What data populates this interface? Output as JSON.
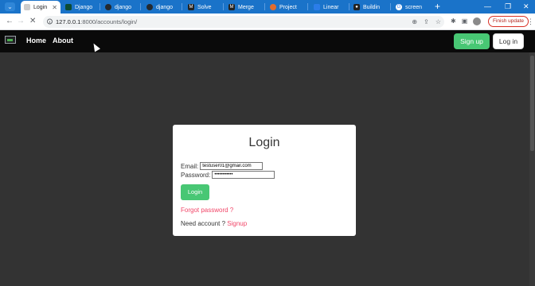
{
  "browser": {
    "active_tab": {
      "title": "Login"
    },
    "tabs": [
      {
        "title": "Django",
        "icon": "django-icon",
        "color": "#0c4b33"
      },
      {
        "title": "django",
        "icon": "github-icon",
        "color": "#24292f"
      },
      {
        "title": "django",
        "icon": "github-icon",
        "color": "#24292f"
      },
      {
        "title": "Solve",
        "icon": "solve-icon",
        "color": "#222222"
      },
      {
        "title": "Merge",
        "icon": "merge-icon",
        "color": "#222222"
      },
      {
        "title": "Project",
        "icon": "project-icon",
        "color": "#e06c2f"
      },
      {
        "title": "Linear",
        "icon": "linear-icon",
        "color": "#2b7de9"
      },
      {
        "title": "Buildin",
        "icon": "build-icon",
        "color": "#222222"
      },
      {
        "title": "screen",
        "icon": "google-icon",
        "color": "#ffffff"
      }
    ],
    "url_host": "127.0.0.1",
    "url_path": ":8000/accounts/login/",
    "finish_update_label": "Finish update"
  },
  "navbar": {
    "links": [
      "Home",
      "About"
    ],
    "signup_label": "Sign up",
    "login_label": "Log in"
  },
  "login_card": {
    "title": "Login",
    "email_label": "Email:",
    "email_value": "testuser01@gmail.com",
    "password_label": "Password:",
    "password_value": "•••••••••••",
    "submit_label": "Login",
    "forgot_label": "Forgot password ?",
    "need_account_text": "Need account ?",
    "signup_link": "Signup"
  },
  "colors": {
    "accent_green": "#48c774",
    "link_red": "#f14668",
    "page_bg": "#333333",
    "tabstrip_blue": "#1a73c9"
  }
}
